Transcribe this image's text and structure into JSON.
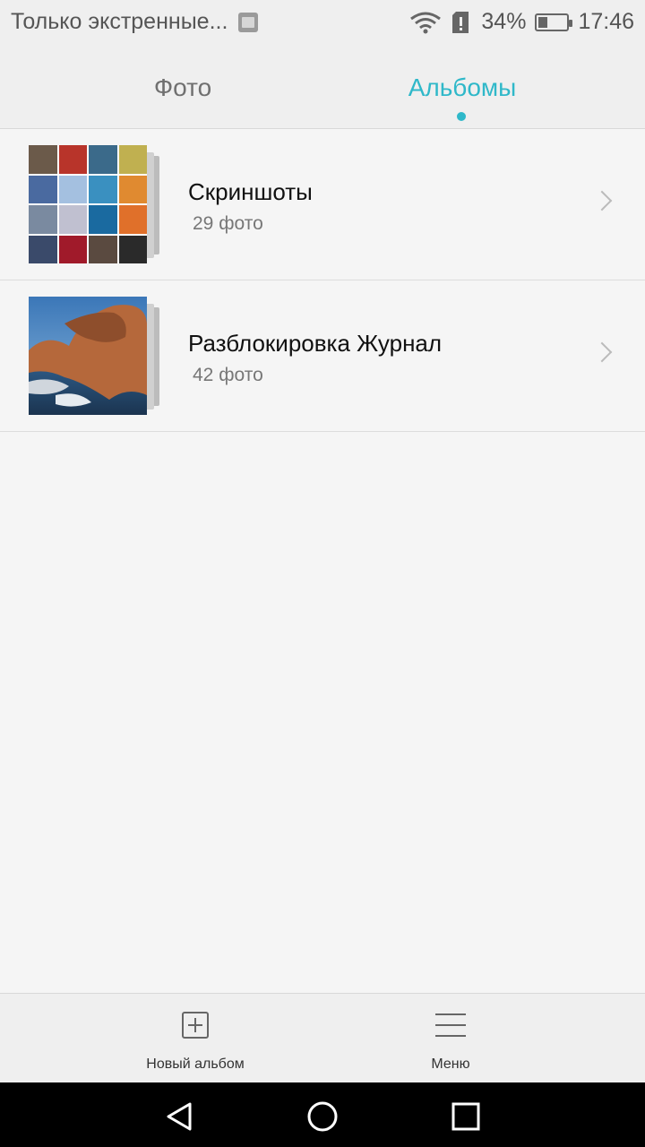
{
  "status": {
    "carrier_text": "Только экстренные...",
    "battery_percent": "34%",
    "battery_level": 0.34,
    "time": "17:46",
    "icons": [
      "gallery-icon",
      "wifi-icon",
      "sim-alert-icon",
      "battery-icon"
    ]
  },
  "tabs": [
    {
      "label": "Фото",
      "active": false
    },
    {
      "label": "Альбомы",
      "active": true
    }
  ],
  "accent_color": "#2fb8c9",
  "albums": [
    {
      "title": "Скриншоты",
      "count": "29 фото",
      "thumb_colors": [
        "#6b5a4a",
        "#b8342a",
        "#3b6a8a",
        "#c0b050",
        "#4a6aa0",
        "#a4c0e0",
        "#3a90c0",
        "#e08a30",
        "#7a8aa0",
        "#c0c0d0",
        "#1a6aa0",
        "#e0702a",
        "#3a4a6a",
        "#a01a2a",
        "#5a4a40",
        "#2a2a2a"
      ]
    },
    {
      "title": "Разблокировка Журнал",
      "count": "42 фото",
      "thumb_colors": [
        "#4a88c4",
        "#c27a4a",
        "#2a4a6a",
        "#a8643a"
      ]
    }
  ],
  "bottom": {
    "new_album": "Новый альбом",
    "menu": "Меню"
  }
}
